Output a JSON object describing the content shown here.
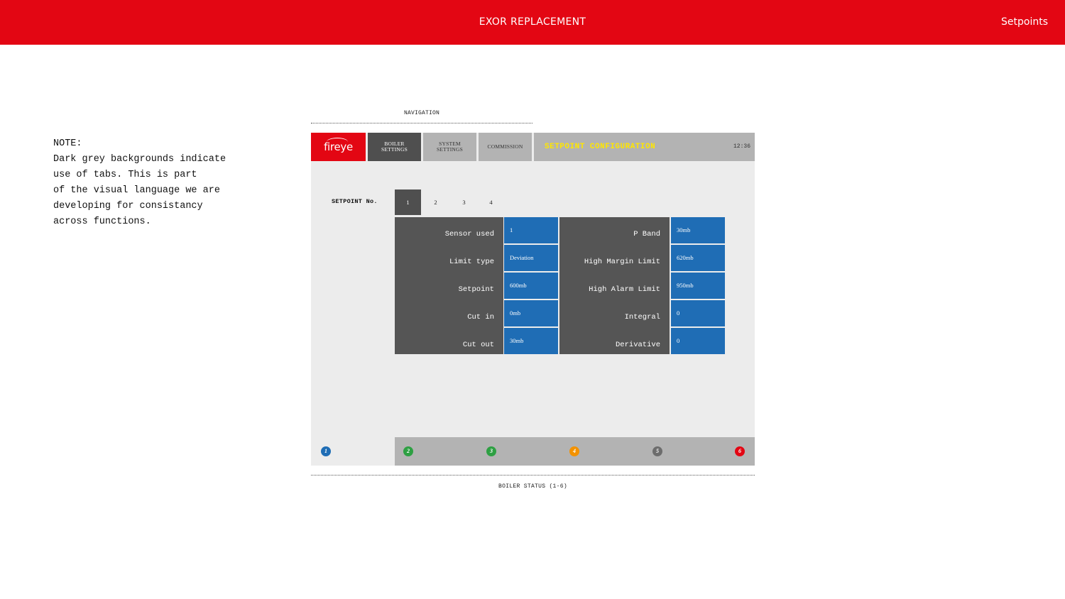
{
  "topbar": {
    "title": "EXOR REPLACEMENT",
    "page": "Setpoints",
    "color": "#e30613"
  },
  "note": {
    "lines": [
      "NOTE:",
      "Dark grey backgrounds indicate",
      "use of tabs. This is part",
      "of the visual language we are",
      "developing for consistancy",
      "across functions."
    ]
  },
  "navigation_label": "NAVIGATION",
  "screen": {
    "logo": "fireye",
    "tabs": [
      {
        "line1": "BOILER",
        "line2": "SETTINGS"
      },
      {
        "line1": "SYSTEM",
        "line2": "SETTINGS"
      },
      {
        "line1": "COMMISSION",
        "line2": ""
      }
    ],
    "heading": "SETPOINT CONFIGURATION",
    "time": "12:36",
    "setpoint_label": "SETPOINT No.",
    "setpoint_numbers": [
      "1",
      "2",
      "3",
      "4"
    ],
    "active_setpoint": "1",
    "left_fields": [
      {
        "label": "Sensor used",
        "value": "1"
      },
      {
        "label": "Limit type",
        "value": "Deviation"
      },
      {
        "label": "Setpoint",
        "value": "600mb"
      },
      {
        "label": "Cut in",
        "value": "0mb"
      },
      {
        "label": "Cut out",
        "value": "30mb"
      }
    ],
    "right_fields": [
      {
        "label": "P Band",
        "value": "30mb"
      },
      {
        "label": "High Margin Limit",
        "value": "620mb"
      },
      {
        "label": "High Alarm Limit",
        "value": "950mb"
      },
      {
        "label": "Integral",
        "value": "0"
      },
      {
        "label": "Derivative",
        "value": "0"
      }
    ],
    "boilers": [
      {
        "label": "1",
        "color": "#1f6db5"
      },
      {
        "label": "2",
        "color": "#2ea043"
      },
      {
        "label": "3",
        "color": "#2ea043"
      },
      {
        "label": "4",
        "color": "#f39200"
      },
      {
        "label": "5",
        "color": "#6d6d6d"
      },
      {
        "label": "6",
        "color": "#e30613"
      }
    ]
  },
  "boiler_status_label": "BOILER STATUS (1-6)"
}
